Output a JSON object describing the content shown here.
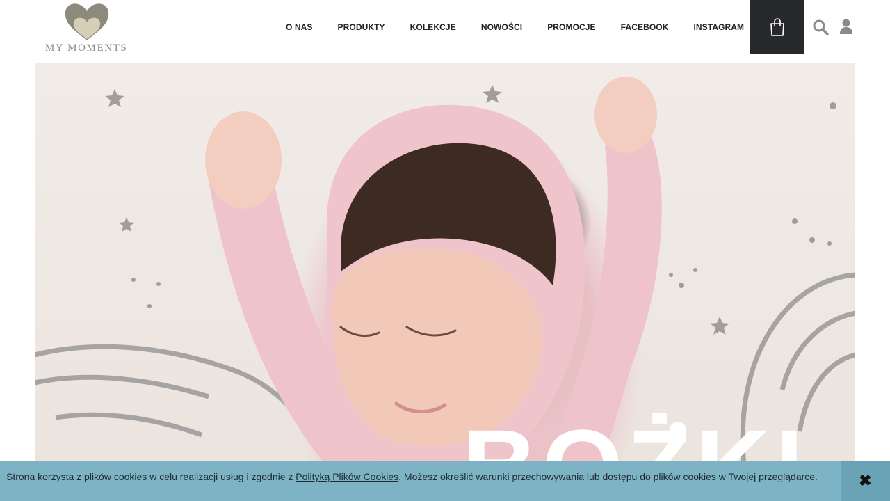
{
  "brand": {
    "logo_text": "MY MOMENTS"
  },
  "nav": {
    "items": [
      {
        "label": "O NAS"
      },
      {
        "label": "PRODUKTY"
      },
      {
        "label": "KOLEKCJE"
      },
      {
        "label": "NOWOŚCI"
      },
      {
        "label": "PROMOCJE"
      },
      {
        "label": "FACEBOOK"
      },
      {
        "label": "INSTAGRAM"
      }
    ]
  },
  "icons": {
    "cart": "shopping-bag-icon",
    "search": "search-icon",
    "user": "user-icon",
    "close": "close-icon"
  },
  "hero": {
    "overlay_text": "BOŻKI"
  },
  "cookie": {
    "text_before": "Strona korzysta z plików cookies w celu realizacji usług i zgodnie z ",
    "link_text": "Polityką Plików Cookies",
    "text_after": ". Możesz określić warunki przechowywania lub dostępu do plików cookies w Twojej przeglądarce.",
    "close_symbol": "✖"
  },
  "colors": {
    "cart_bg": "#27292b",
    "cookie_bg": "#7db3c4",
    "logo_primary": "#8b8a7c",
    "logo_secondary": "#d6cfb8"
  }
}
